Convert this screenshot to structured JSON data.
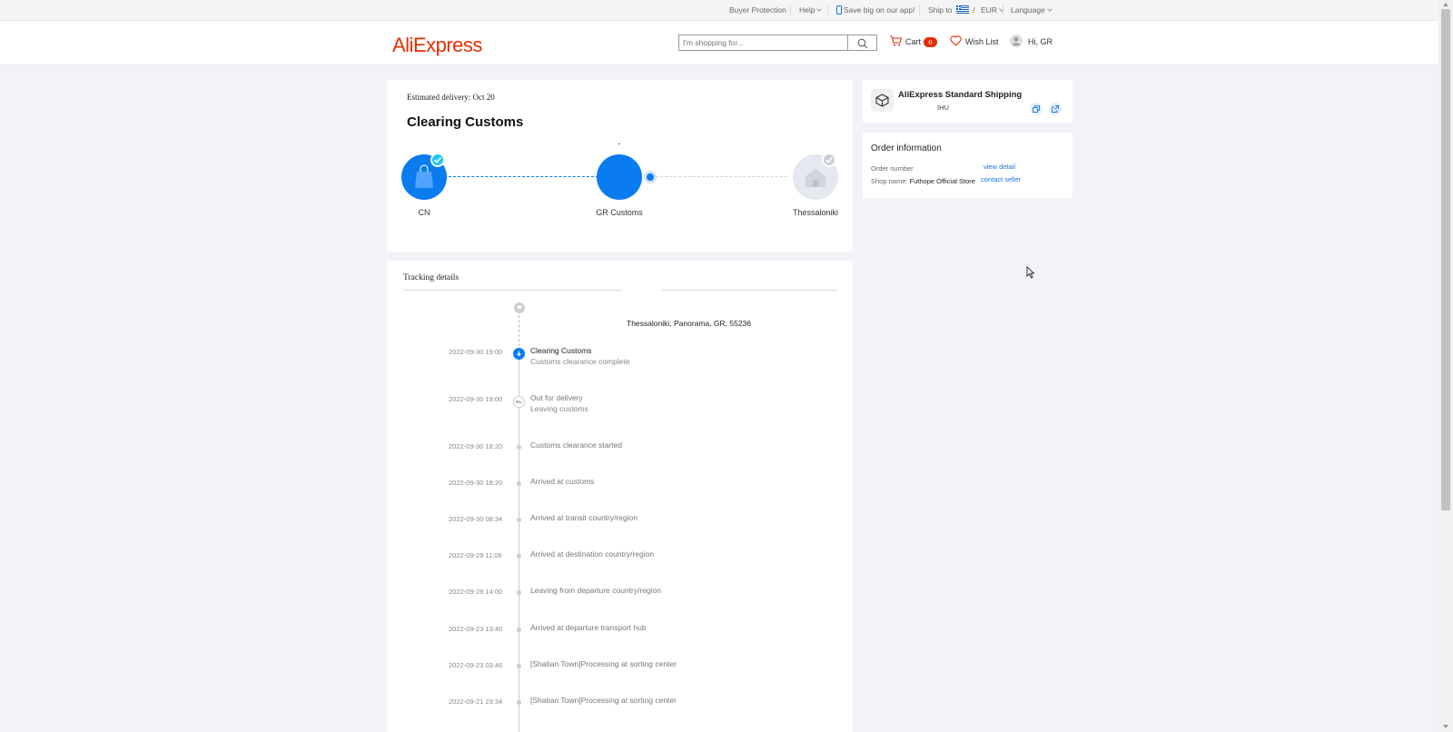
{
  "topbar": {
    "buyer_protection": "Buyer Protection",
    "help": "Help",
    "app": "Save big on our app!",
    "ship_to": "Ship to",
    "currency_sep": "/",
    "currency": "EUR",
    "language": "Language"
  },
  "header": {
    "logo": "AliExpress",
    "search_placeholder": "I'm shopping for...",
    "cart_label": "Cart",
    "cart_count": "0",
    "wishlist": "Wish List",
    "greeting": "Hi, GR",
    "brand_color": "#e62e04"
  },
  "summary": {
    "estimated_delivery": "Estimated delivery: Oct 20",
    "status_title": "Clearing Customs",
    "nodes": [
      {
        "label": "CN",
        "state": "done"
      },
      {
        "label": "GR Customs",
        "state": "current"
      },
      {
        "label": "Thessaloniki",
        "state": "pending"
      }
    ]
  },
  "tracking": {
    "title": "Tracking details",
    "address": "Thessaloniki,  Panorama,  GR,  55236",
    "events": [
      {
        "time": "2022-09-30 19:00",
        "title": "Clearing Customs",
        "sub": "Customs clearance complete"
      },
      {
        "time": "2022-09-30 19:00",
        "title": "Out for delivery",
        "sub": "Leaving customs"
      },
      {
        "time": "2022-09-30 18:20",
        "title": "Customs clearance started",
        "sub": ""
      },
      {
        "time": "2022-09-30 18:20",
        "title": "Arrived at customs",
        "sub": ""
      },
      {
        "time": "2022-09-30 08:34",
        "title": "Arrived at transit country/region",
        "sub": ""
      },
      {
        "time": "2022-09-29 11:06",
        "title": "Arrived at destination country/region",
        "sub": ""
      },
      {
        "time": "2022-09-28 14:00",
        "title": "Leaving from departure country/region",
        "sub": ""
      },
      {
        "time": "2022-09-23 13:40",
        "title": "Arrived at departure transport hub",
        "sub": ""
      },
      {
        "time": "2022-09-23 03:46",
        "title": "[Shatian Town]Processing at sorting center",
        "sub": ""
      },
      {
        "time": "2022-09-21 23:34",
        "title": "[Shatian Town]Processing at sorting center",
        "sub": ""
      }
    ]
  },
  "shipping": {
    "name": "AliExpress Standard Shipping",
    "code": "IHU"
  },
  "order": {
    "title": "Order information",
    "number_label": "Order number",
    "view_detail": "view detail",
    "shop_label": "Shop name:",
    "shop_name": "Futhope Official Store",
    "contact_seller": "contact seller"
  },
  "colors": {
    "accent": "#0a7cf0",
    "link": "#1a73e8"
  }
}
